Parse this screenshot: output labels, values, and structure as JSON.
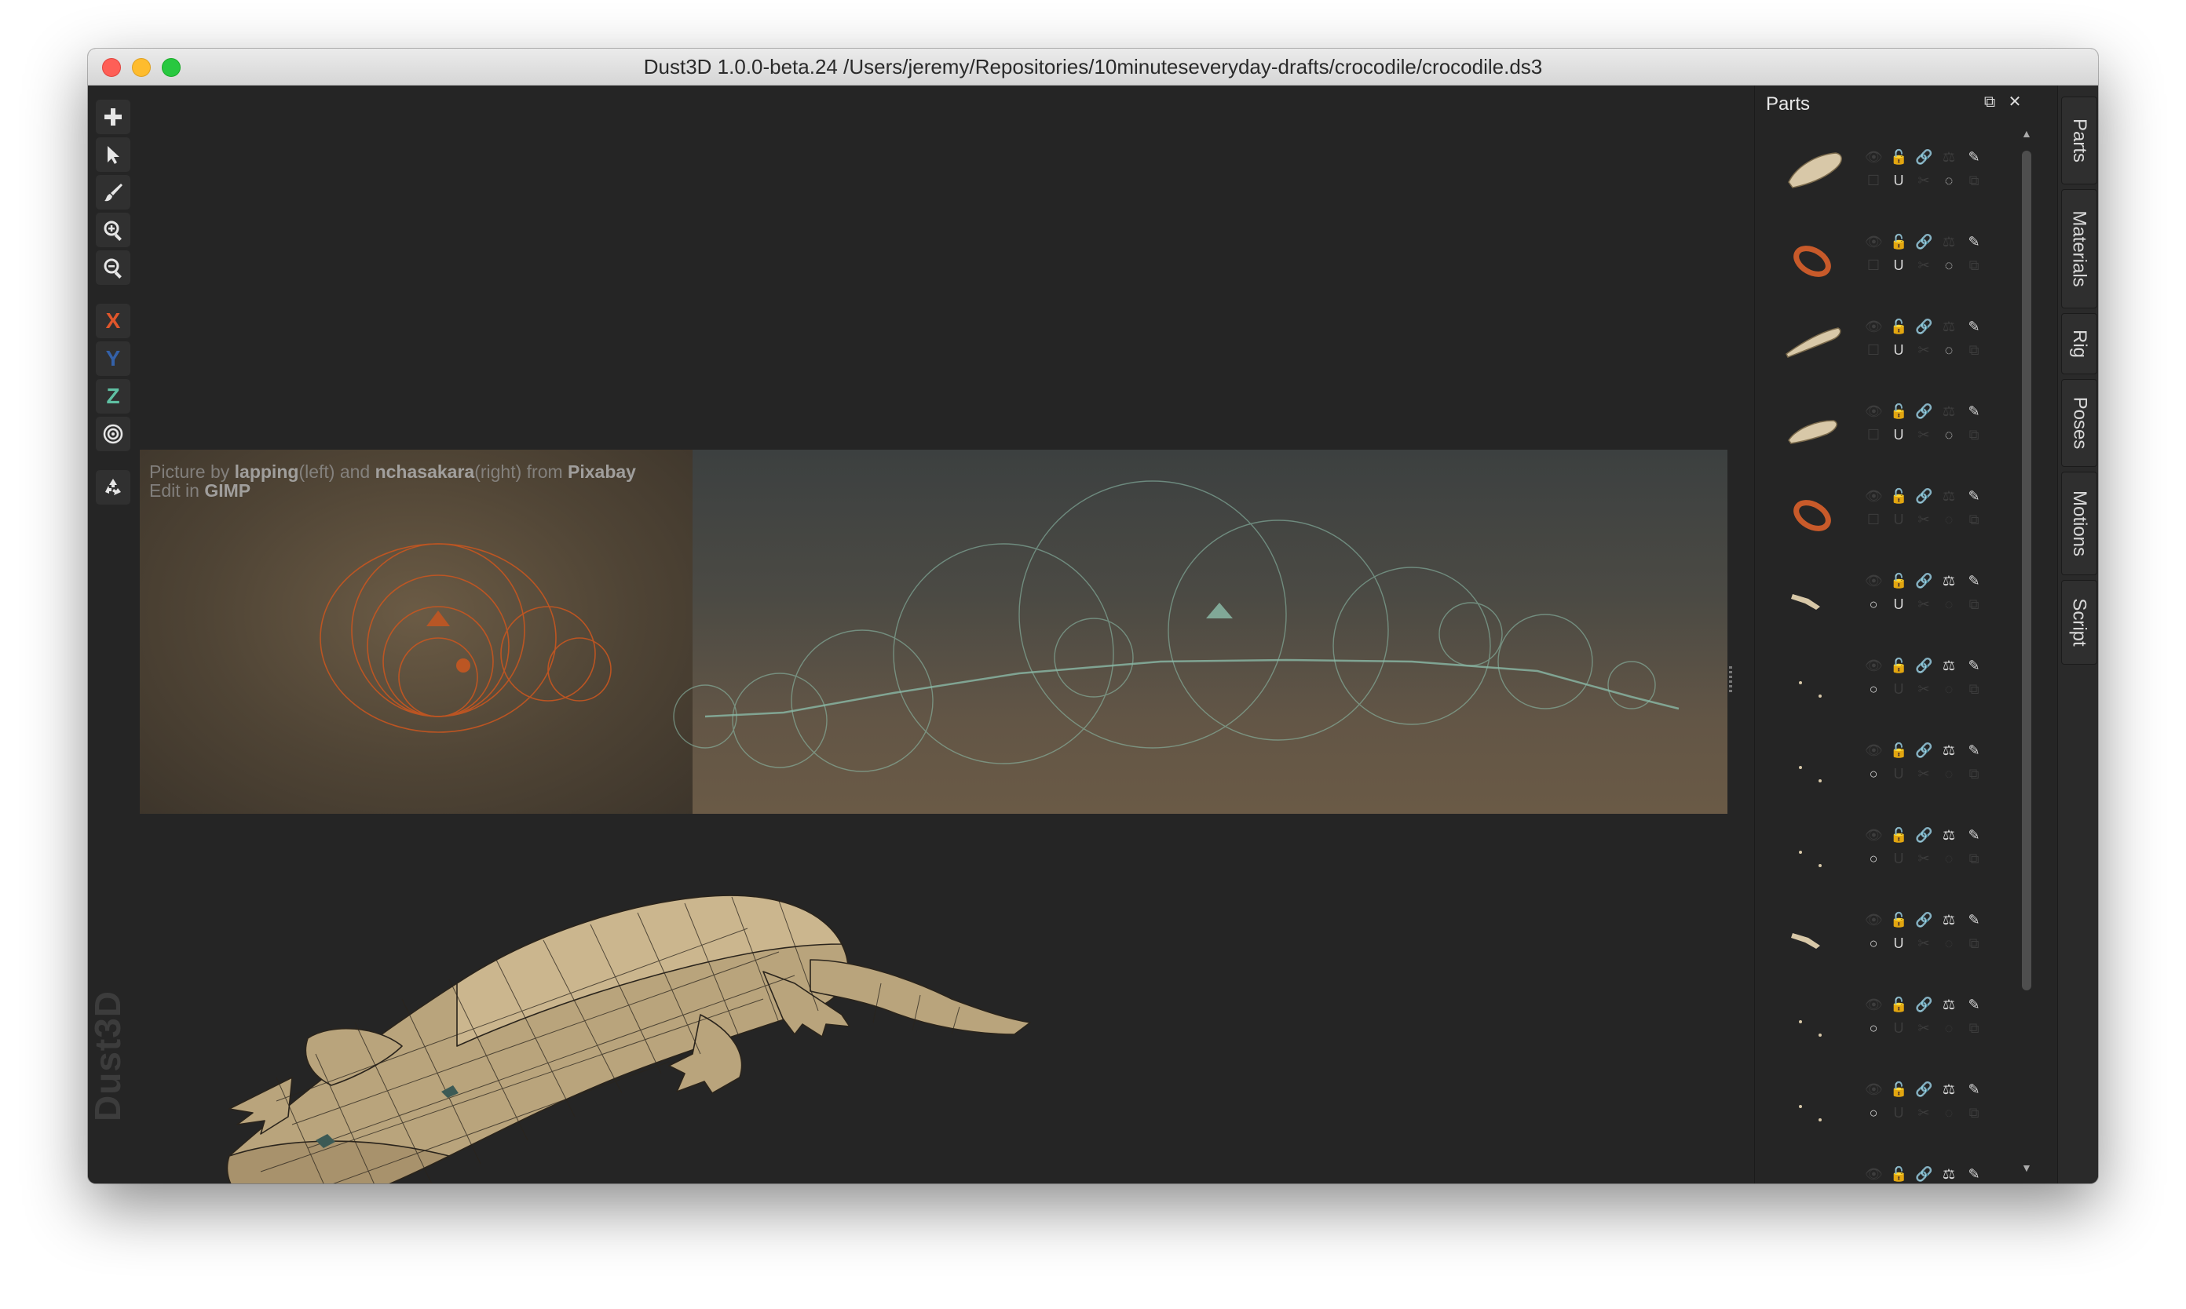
{
  "window": {
    "title": "Dust3D 1.0.0-beta.24 /Users/jeremy/Repositories/10minuteseveryday-drafts/crocodile/crocodile.ds3"
  },
  "toolbar": {
    "tools": [
      {
        "name": "add",
        "icon": "plus-icon"
      },
      {
        "name": "select",
        "icon": "cursor-icon"
      },
      {
        "name": "paint",
        "icon": "brush-icon"
      },
      {
        "name": "zoom-in",
        "icon": "zoom-in-icon"
      },
      {
        "name": "zoom-out",
        "icon": "zoom-out-icon"
      }
    ],
    "axes": {
      "x": "X",
      "y": "Y",
      "z": "Z"
    },
    "axis_colors": {
      "x": "#e0562b",
      "y": "#3461a8",
      "z": "#5fc0a3"
    },
    "radial_icon": "radial-icon",
    "regenerate_icon": "recycle-icon"
  },
  "reference": {
    "credit_prefix": "Picture by ",
    "credit_author1": "lapping",
    "credit_mid1": "(left) and ",
    "credit_author2": "nchasakara",
    "credit_mid2": "(right) from ",
    "credit_site": "Pixabay",
    "credit_line2_prefix": "Edit in ",
    "credit_tool": "GIMP"
  },
  "watermark": "Dust3D",
  "parts_panel": {
    "title": "Parts",
    "float_icon": "float-window-icon",
    "close_icon": "close-icon",
    "rows": [
      {
        "thumb": "head",
        "color": "#d8c8a8",
        "locked": true,
        "xmirror": false
      },
      {
        "thumb": "ring",
        "color": "#c85a2a",
        "locked": true,
        "xmirror": false
      },
      {
        "thumb": "tail",
        "color": "#d8c8a8",
        "locked": true,
        "xmirror": false
      },
      {
        "thumb": "body",
        "color": "#d8c8a8",
        "locked": true,
        "xmirror": false
      },
      {
        "thumb": "ring",
        "color": "#c85a2a",
        "locked": false,
        "xmirror": false
      },
      {
        "thumb": "leg",
        "color": "#d8c8a8",
        "locked": true,
        "xmirror": true
      },
      {
        "thumb": "dot",
        "color": "#d8c8a8",
        "locked": false,
        "xmirror": true
      },
      {
        "thumb": "dot",
        "color": "#d8c8a8",
        "locked": false,
        "xmirror": true
      },
      {
        "thumb": "dot",
        "color": "#d8c8a8",
        "locked": false,
        "xmirror": true
      },
      {
        "thumb": "leg",
        "color": "#d8c8a8",
        "locked": true,
        "xmirror": true
      },
      {
        "thumb": "dot",
        "color": "#d8c8a8",
        "locked": false,
        "xmirror": true
      },
      {
        "thumb": "dot",
        "color": "#d8c8a8",
        "locked": false,
        "xmirror": true
      },
      {
        "thumb": "dot",
        "color": "#d8c8a8",
        "locked": false,
        "xmirror": true
      }
    ]
  },
  "right_tabs": [
    "Parts",
    "Materials",
    "Rig",
    "Poses",
    "Motions",
    "Script"
  ]
}
